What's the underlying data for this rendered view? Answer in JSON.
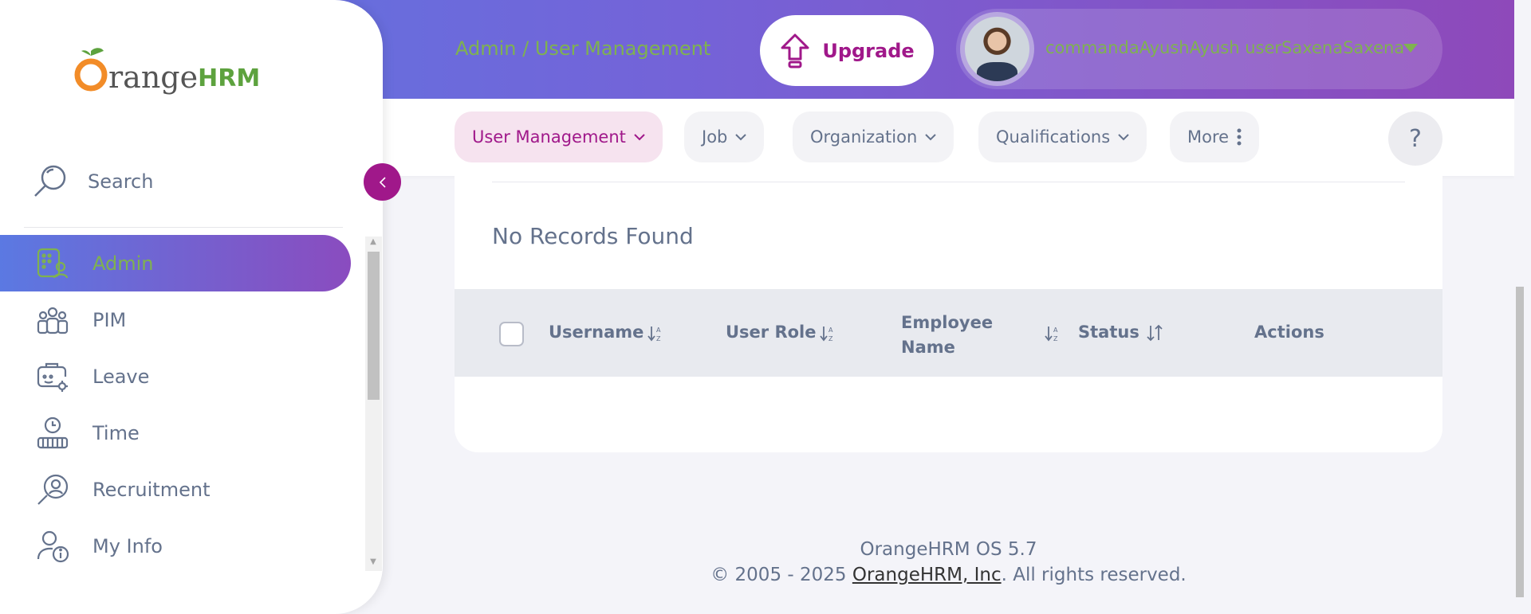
{
  "header": {
    "breadcrumb": "Admin / User Management",
    "upgrade_label": "Upgrade",
    "user_name": "commandaAyushAyush userSaxenaSaxena"
  },
  "topnav": {
    "items": [
      {
        "label": "User Management",
        "active": true
      },
      {
        "label": "Job"
      },
      {
        "label": "Organization"
      },
      {
        "label": "Qualifications"
      },
      {
        "label": "More"
      }
    ],
    "help_label": "?"
  },
  "content": {
    "empty_message": "No Records Found",
    "table": {
      "columns": [
        "Username",
        "User Role",
        "Employee Name",
        "Status",
        "Actions"
      ]
    }
  },
  "footer": {
    "version": "OrangeHRM OS 5.7",
    "copyright_prefix": "© 2005 - 2025 ",
    "company_link": "OrangeHRM, Inc",
    "copyright_suffix": ". All rights reserved."
  },
  "sidebar": {
    "logo_text": "range",
    "logo_hrm": "HRM",
    "search_label": "Search",
    "items": [
      {
        "label": "Admin",
        "icon": "admin-icon",
        "active": true
      },
      {
        "label": "PIM",
        "icon": "pim-icon"
      },
      {
        "label": "Leave",
        "icon": "leave-icon"
      },
      {
        "label": "Time",
        "icon": "time-icon"
      },
      {
        "label": "Recruitment",
        "icon": "recruitment-icon"
      },
      {
        "label": "My Info",
        "icon": "my-info-icon"
      }
    ]
  },
  "colors": {
    "brand_purple": "#a0188a",
    "accent_green": "#7fb24f",
    "gradient_start": "#5b79e2",
    "gradient_end": "#8e49ba"
  }
}
